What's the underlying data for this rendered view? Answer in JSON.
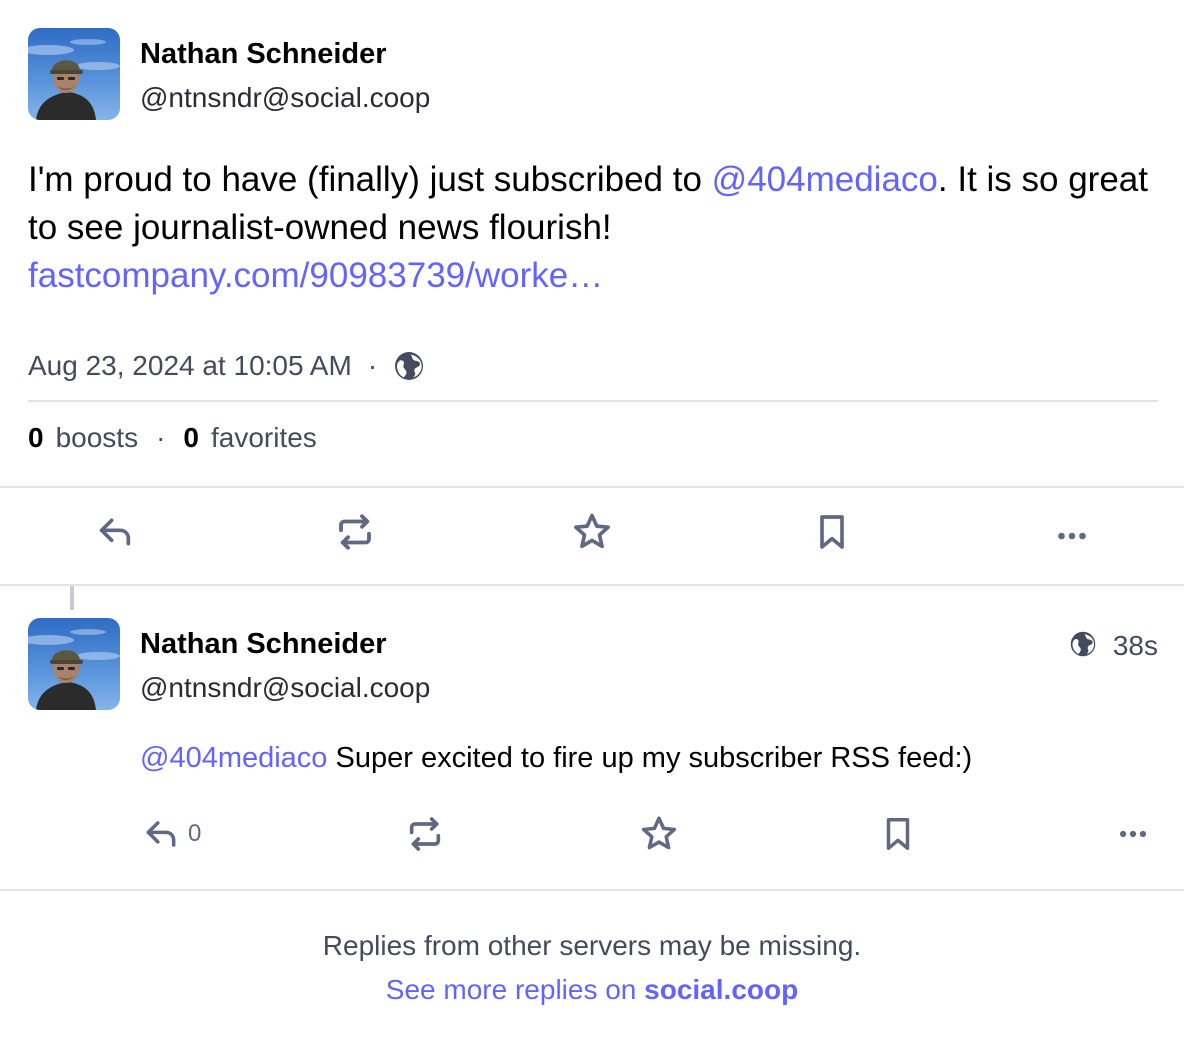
{
  "main_status": {
    "author": {
      "display_name": "Nathan Schneider",
      "acct": "@ntnsndr@social.coop"
    },
    "content": {
      "part1": "I'm proud to have (finally) just subscribed to ",
      "mention": "@404mediaco",
      "part2": ". It is so great to see journalist-owned news flourish!",
      "link": "fastcompany.com/90983739/worke…"
    },
    "timestamp": "Aug 23, 2024 at 10:05 AM",
    "separator": "·",
    "visibility_icon": "globe-icon",
    "stats": {
      "boosts_count": "0",
      "boosts_label": "boosts",
      "favorites_count": "0",
      "favorites_label": "favorites",
      "separator": "·"
    },
    "actions": [
      "reply-icon",
      "boost-icon",
      "favorite-icon",
      "bookmark-icon",
      "more-icon"
    ]
  },
  "reply_status": {
    "author": {
      "display_name": "Nathan Schneider",
      "acct": "@ntnsndr@social.coop"
    },
    "relative_time": "38s",
    "visibility_icon": "globe-icon",
    "content": {
      "mention": "@404mediaco",
      "text": " Super excited to fire up my subscriber RSS feed:)"
    },
    "reply_count": "0",
    "actions": [
      "reply-icon",
      "boost-icon",
      "favorite-icon",
      "bookmark-icon",
      "more-icon"
    ]
  },
  "footer": {
    "notice": "Replies from other servers may be missing.",
    "more_prefix": "See more replies on ",
    "more_domain": "social.coop"
  },
  "colors": {
    "accent": "#6364ff",
    "muted_text": "#444b5d",
    "icon": "#606984",
    "divider": "#e2e2e8"
  }
}
